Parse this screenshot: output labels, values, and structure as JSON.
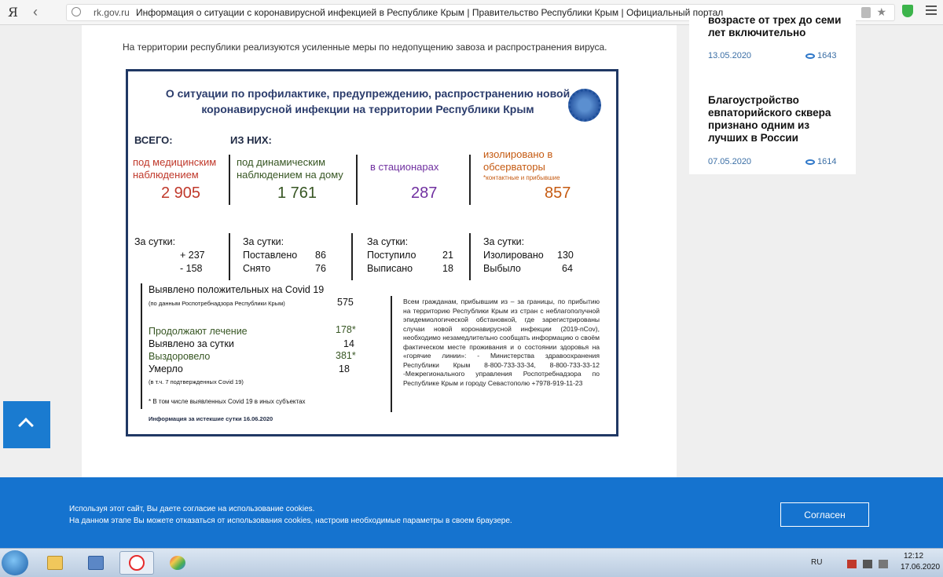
{
  "browser": {
    "logo": "Я",
    "url_host": "rk.gov.ru",
    "page_title": "Информация о ситуации с коронавирусной инфекцией в Республике Крым | Правительство Республики Крым | Официальный портал"
  },
  "main": {
    "intro": "На территории республики реализуются усиленные меры по недопущению завоза и распространения вируса."
  },
  "infographic": {
    "title": "О ситуации по профилактике, предупреждению, распространению новой коронавирусной инфекции на территории Республики Крым",
    "total_label": "ВСЕГО:",
    "of_them_label": "ИЗ НИХ:",
    "medical_label": "под медицинским наблюдением",
    "medical_value": "2 905",
    "home_label": "под динамическим наблюдением на дому",
    "home_value": "1 761",
    "hospital_label": "в стационарах",
    "hospital_value": "287",
    "observatory_label": "изолировано в обсерваторы",
    "observatory_note": "*контактные и прибывшие",
    "observatory_value": "857",
    "day_label": "За сутки:",
    "col1": {
      "line1": "+ 237",
      "line2": "-  158"
    },
    "col2": {
      "label1": "Поставлено",
      "value1": "86",
      "label2": "Снято",
      "value2": "76"
    },
    "col3": {
      "label1": "Поступило",
      "value1": "21",
      "label2": "Выписано",
      "value2": "18"
    },
    "col4": {
      "label1": "Изолировано",
      "value1": "130",
      "label2": "Выбыло",
      "value2": "64"
    },
    "covid_label": "Выявлено положительных на Covid 19",
    "covid_source": "(по данным Роспотребнадзора Республики Крым)",
    "covid_value": "575",
    "treatment_label": "Продолжают лечение",
    "treatment_value": "178*",
    "detected_label": "Выявлено за сутки",
    "detected_value": "14",
    "recovered_label": "Выздоровело",
    "recovered_value": "381*",
    "died_label": "Умерло",
    "died_value": "18",
    "died_note": "(в т.ч. 7 подтвержденных Covid 19)",
    "footnote": "* В том числе выявленных Covid 19  в иных субъектах",
    "date_line": "Информация за истекшие сутки 16.06.2020",
    "notice": "Всем гражданам, прибывшим из – за границы, по прибытию на территорию Республики Крым из стран с неблагополучной эпидемиологической обстановкой, где зарегистрированы случаи новой коронавирусной инфекции (2019-nCov), необходимо незамедлительно сообщать информацию о своём фактическом месте проживания и о состоянии здоровья на «горячие линии»: - Министерства здравоохранения Республики Крым 8-800-733-33-34, 8-800-733-33-12 -Межрегионального управления Роспотребнадзора по Республике Крым и городу Севастополю +7978-919-11-23"
  },
  "sidebar": {
    "card1": {
      "title": "возрасте от трех до семи лет включительно",
      "date": "13.05.2020",
      "views": "1643"
    },
    "card2": {
      "title": "Благоустройство евпаторийского сквера признано одним из лучших в России",
      "date": "07.05.2020",
      "views": "1614"
    }
  },
  "cookie": {
    "line1": "Используя этот сайт, Вы даете согласие на использование cookies.",
    "line2": "На данном этапе Вы можете отказаться от использования cookies, настроив необходимые параметры в своем браузере.",
    "button": "Согласен"
  },
  "taskbar": {
    "lang": "RU",
    "time": "12:12",
    "date": "17.06.2020"
  },
  "icons": [
    "start-icon",
    "explorer-icon",
    "remote-desktop-icon",
    "yandex-browser-icon",
    "paint-icon",
    "virus-icon",
    "eye-icon",
    "chevron-up-icon"
  ]
}
